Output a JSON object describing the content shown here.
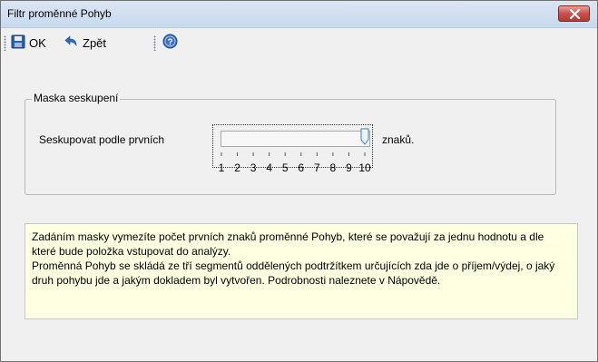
{
  "window": {
    "title": "Filtr proměnné Pohyb"
  },
  "toolbar": {
    "ok_label": "OK",
    "back_label": "Zpět"
  },
  "group": {
    "title": "Maska seskupení",
    "label_before": "Seskupovat podle prvních",
    "label_after": "znaků."
  },
  "slider": {
    "min": 1,
    "max": 10,
    "value": 10,
    "ticks": [
      "1",
      "2",
      "3",
      "4",
      "5",
      "6",
      "7",
      "8",
      "9",
      "10"
    ]
  },
  "info": {
    "paragraph1": "Zadáním masky vymezíte počet prvních znaků proměnné Pohyb, které se považují za jednu hodnotu a dle které bude položka vstupovat do analýzy.",
    "paragraph2": "Proměnná Pohyb se skládá ze tří segmentů oddělených podtržítkem určujících zda jde o příjem/výdej, o jaký druh pohybu jde a jakým dokladem byl vytvořen. Podrobnosti naleznete v Nápovědě."
  },
  "icons": {
    "save": "floppy-disk-icon",
    "undo": "undo-arrow-icon",
    "help": "help-question-icon",
    "close": "close-x-icon"
  },
  "colors": {
    "close_button": "#c75050",
    "info_background": "#ffffe1",
    "titlebar": "#c9d9ee"
  }
}
